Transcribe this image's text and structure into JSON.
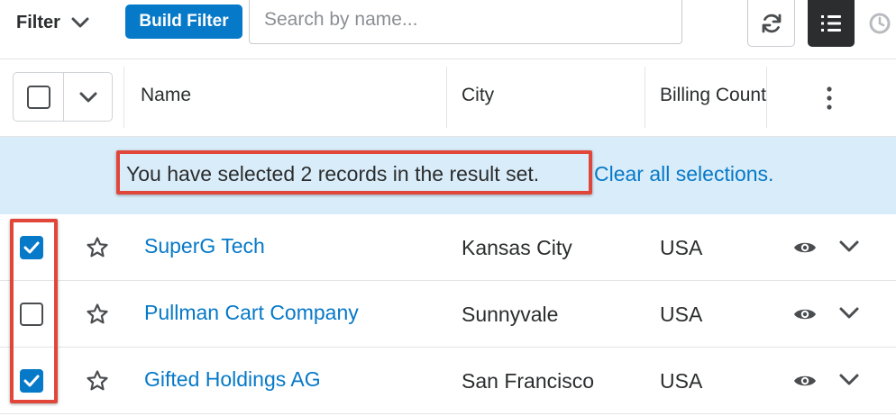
{
  "toolbar": {
    "filter_label": "Filter",
    "build_filter_label": "Build Filter",
    "search_placeholder": "Search by name...",
    "search_value": "",
    "icons": {
      "filter_caret": "chevron-down-icon",
      "refresh": "refresh-icon",
      "list_view": "list-view-icon",
      "clock": "clock-icon"
    }
  },
  "table": {
    "columns": [
      {
        "label": "Name"
      },
      {
        "label": "City"
      },
      {
        "label": "Billing Country"
      }
    ],
    "rows": [
      {
        "checked": true,
        "name": "SuperG Tech",
        "city": "Kansas City",
        "country": "USA"
      },
      {
        "checked": false,
        "name": "Pullman Cart Company",
        "city": "Sunnyvale",
        "country": "USA"
      },
      {
        "checked": true,
        "name": "Gifted Holdings AG",
        "city": "San Francisco",
        "country": "USA"
      }
    ]
  },
  "banner": {
    "message": "You have selected 2 records in the result set.",
    "link": "Clear all selections."
  },
  "colors": {
    "accent": "#0679c8",
    "banner_bg": "#d9ecf9",
    "highlight": "#e0473a",
    "text": "#2b2d2e"
  }
}
